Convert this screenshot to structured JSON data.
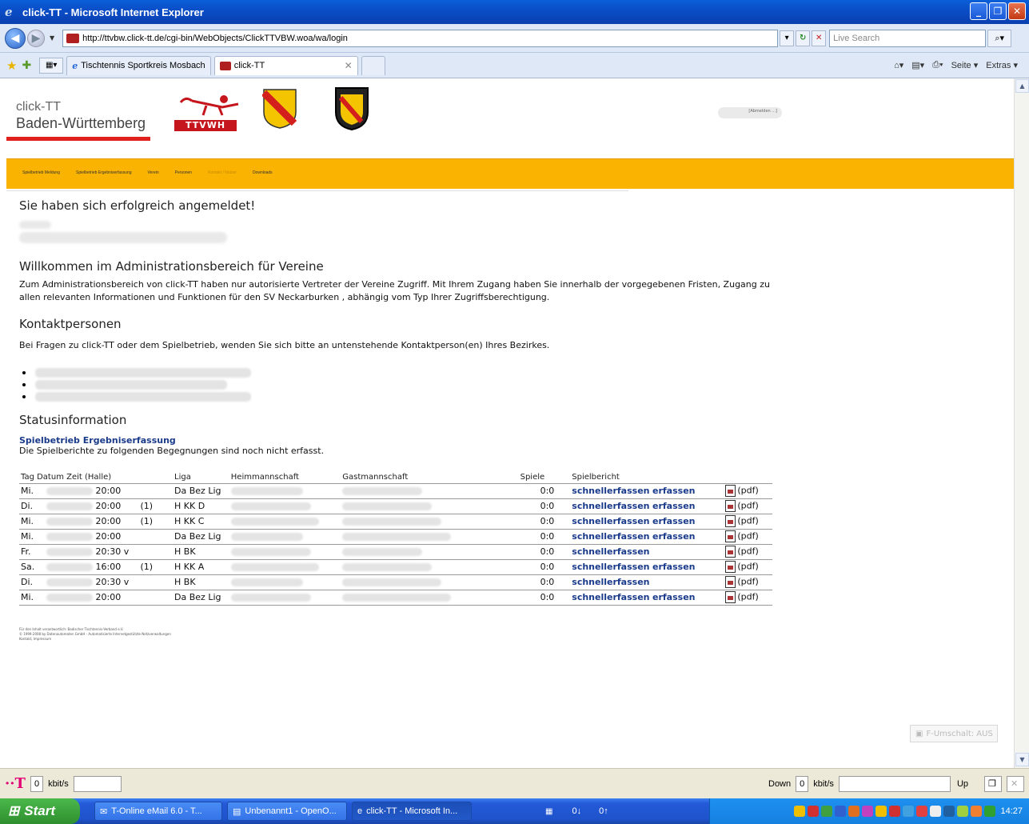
{
  "window": {
    "title": "click-TT - Microsoft Internet Explorer",
    "minimize": "_",
    "maximize": "❐",
    "close": "✕"
  },
  "address": {
    "url": "http://ttvbw.click-tt.de/cgi-bin/WebObjects/ClickTTVBW.woa/wa/login",
    "search_placeholder": "Live Search"
  },
  "tabs": [
    {
      "label": "Tischtennis Sportkreis Mosbach"
    },
    {
      "label": "click-TT"
    }
  ],
  "commandbar": {
    "page": "Seite ▾",
    "extras": "Extras ▾"
  },
  "site": {
    "brand_line1": "click-TT",
    "brand_line2": "Baden-Württemberg",
    "logo1_text": "TTVWH",
    "login_link": "[Abmelden ...]",
    "menu": [
      "Spielbetrieb Meldung",
      "Spielbetrieb Ergebniserfassung",
      "Verein",
      "Personen",
      "Kontakt / Nutzer",
      "Downloads"
    ]
  },
  "main": {
    "success": "Sie haben sich erfolgreich angemeldet!",
    "welcome_title": "Willkommen im Administrationsbereich für Vereine",
    "welcome_text": "Zum Administrationsbereich von click-TT haben nur autorisierte Vertreter der Vereine Zugriff. Mit Ihrem Zugang haben Sie innerhalb der vorgegebenen Fristen, Zugang zu allen relevanten Informationen und Funktionen für den SV Neckarburken , abhängig vom Typ Ihrer Zugriffsberechtigung.",
    "contact_title": "Kontaktpersonen",
    "contact_text": "Bei Fragen zu click-TT oder dem Spielbetrieb, wenden Sie sich bitte an untenstehende Kontaktperson(en) Ihres Bezirkes.",
    "status_title": "Statusinformation",
    "status_link": "Spielbetrieb Ergebniserfassung",
    "status_text": "Die Spielberichte zu folgenden Begegnungen sind noch nicht erfasst."
  },
  "table": {
    "headers": {
      "tag": "Tag Datum Zeit (Halle)",
      "liga": "Liga",
      "heim": "Heimmannschaft",
      "gast": "Gastmannschaft",
      "spiele": "Spiele",
      "bericht": "Spielbericht"
    },
    "rows": [
      {
        "tag": "Mi.",
        "zeit": "20:00",
        "halle": "",
        "liga": "Da Bez Lig",
        "spiele": "0:0",
        "link1": "schnellerfassen",
        "link2": "erfassen",
        "pdf": "(pdf)"
      },
      {
        "tag": "Di.",
        "zeit": "20:00",
        "halle": "(1)",
        "liga": "H KK D",
        "spiele": "0:0",
        "link1": "schnellerfassen",
        "link2": "erfassen",
        "pdf": "(pdf)"
      },
      {
        "tag": "Mi.",
        "zeit": "20:00",
        "halle": "(1)",
        "liga": "H KK C",
        "spiele": "0:0",
        "link1": "schnellerfassen",
        "link2": "erfassen",
        "pdf": "(pdf)"
      },
      {
        "tag": "Mi.",
        "zeit": "20:00",
        "halle": "",
        "liga": "Da Bez Lig",
        "spiele": "0:0",
        "link1": "schnellerfassen",
        "link2": "erfassen",
        "pdf": "(pdf)"
      },
      {
        "tag": "Fr.",
        "zeit": "20:30 v",
        "halle": "",
        "liga": "H BK",
        "spiele": "0:0",
        "link1": "schnellerfassen",
        "link2": "",
        "pdf": "(pdf)"
      },
      {
        "tag": "Sa.",
        "zeit": "16:00",
        "halle": "(1)",
        "liga": "H KK A",
        "spiele": "0:0",
        "link1": "schnellerfassen",
        "link2": "erfassen",
        "pdf": "(pdf)"
      },
      {
        "tag": "Di.",
        "zeit": "20:30 v",
        "halle": "",
        "liga": "H BK",
        "spiele": "0:0",
        "link1": "schnellerfassen",
        "link2": "",
        "pdf": "(pdf)"
      },
      {
        "tag": "Mi.",
        "zeit": "20:00",
        "halle": "",
        "liga": "Da Bez Lig",
        "spiele": "0:0",
        "link1": "schnellerfassen",
        "link2": "erfassen",
        "pdf": "(pdf)"
      }
    ]
  },
  "footer": {
    "line1": "Für den Inhalt verantwortlich: Badischer Tischtennis-Verband e.V.",
    "line2": "© 1999-2008 by Datenautomaten GmbH - Automatisierte Internetgestützte Netzverwaltungen",
    "line3": "Kontakt, Impressum"
  },
  "fschalt": "F-Umschalt: AUS",
  "statusbar": {
    "speed1": "0",
    "unit1": "kbit/s",
    "down": "Down",
    "speed2": "0",
    "unit2": "kbit/s",
    "up": "Up"
  },
  "taskbar": {
    "start": "Start",
    "items": [
      "T-Online eMail 6.0 - T...",
      "Unbenannt1 - OpenO...",
      "click-TT - Microsoft In..."
    ],
    "down": "0↓",
    "up": "0↑",
    "clock": "14:27"
  }
}
